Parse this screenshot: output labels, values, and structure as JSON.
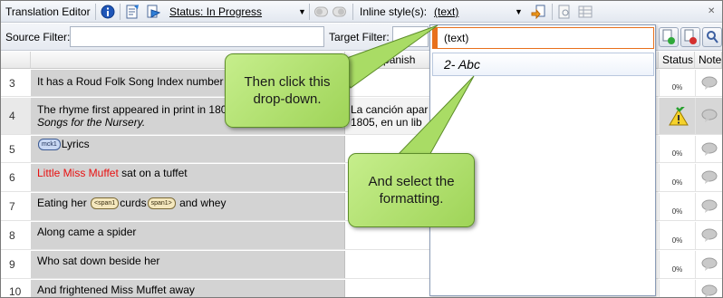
{
  "toolbar": {
    "title": "Translation Editor",
    "status_label": "Status: In Progress",
    "inline_style_label": "Inline style(s):",
    "inline_style_value": "(text)"
  },
  "filters": {
    "source_label": "Source Filter:",
    "target_label": "Target Filter:"
  },
  "grid": {
    "headers": {
      "target": "ates)  Spanish",
      "status": "Status",
      "notes": "Note"
    },
    "rows": [
      {
        "num": "3",
        "source": "It has a Roud Folk Song Index number",
        "target": "",
        "status": "0%"
      },
      {
        "num": "4",
        "source_line1": "The rhyme first appeared in print in 180",
        "source_line2": "Songs for the Nursery.",
        "target_line1": "La canción apar",
        "target_line2": "1805, en un lib",
        "status": ""
      },
      {
        "num": "5",
        "tag": "mck1",
        "source": "Lyrics",
        "status": "0%"
      },
      {
        "num": "6",
        "source_red": "Little Miss Muffet",
        "source_rest": " sat on a tuffet",
        "status": "0%"
      },
      {
        "num": "7",
        "source_a": "Eating her ",
        "tag_open": "<span1",
        "source_b": "curds",
        "tag_close": "span1>",
        "source_c": " and whey",
        "status": "0%"
      },
      {
        "num": "8",
        "source": "Along came a spider",
        "status": "0%"
      },
      {
        "num": "9",
        "source": "Who sat down beside her",
        "status": "0%"
      },
      {
        "num": "10",
        "source": "And frightened Miss Muffet away",
        "status": ""
      }
    ]
  },
  "dropdown": {
    "current": "(text)",
    "option": "2- Abc"
  },
  "callouts": {
    "first": "Then click this drop-down.",
    "second": "And select the formatting."
  },
  "colors": {
    "callout_green": "#b5e274",
    "highlight_orange": "#e8701c",
    "source_gray": "#d3d3d3",
    "red_text": "#e81010"
  }
}
